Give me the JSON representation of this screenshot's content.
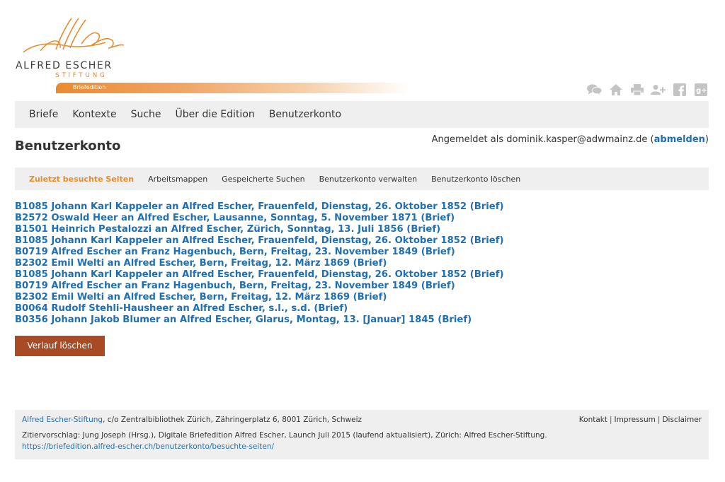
{
  "logo": {
    "name": "ALFRED ESCHER",
    "sub": "STIFTUNG",
    "badge": "Briefedition"
  },
  "colors": {
    "accent": "#e98b2f",
    "link": "#1f6fb5",
    "button": "#a84b25",
    "nav_bg": "#efefef"
  },
  "icons": [
    "comments-icon",
    "home-icon",
    "print-icon",
    "add-user-icon",
    "facebook-icon",
    "google-plus-icon"
  ],
  "nav": [
    "Briefe",
    "Kontexte",
    "Suche",
    "Über die Edition",
    "Benutzerkonto"
  ],
  "page": {
    "title": "Benutzerkonto",
    "login_prefix": "Angemeldet als dominik.kasper@adwmainz.de (",
    "logout": "abmelden",
    "login_suffix": ")"
  },
  "subnav": {
    "active": "Zuletzt besuchte Seiten",
    "items": [
      "Arbeitsmappen",
      "Gespeicherte Suchen",
      "Benutzerkonto verwalten",
      "Benutzerkonto löschen"
    ]
  },
  "visited": [
    "B1085 Johann Karl Kappeler an Alfred Escher, Frauenfeld, Dienstag, 26. Oktober 1852 (Brief)",
    "B2572 Oswald Heer an Alfred Escher, Lausanne, Sonntag, 5. November 1871 (Brief)",
    "B1501 Heinrich Pestalozzi an Alfred Escher, Zürich, Sonntag, 13. Juli 1856 (Brief)",
    "B1085 Johann Karl Kappeler an Alfred Escher, Frauenfeld, Dienstag, 26. Oktober 1852 (Brief)",
    "B0719 Alfred Escher an Franz Hagenbuch, Bern, Freitag, 23. November 1849 (Brief)",
    "B2302 Emil Welti an Alfred Escher, Bern, Freitag, 12. März 1869 (Brief)",
    "B1085 Johann Karl Kappeler an Alfred Escher, Frauenfeld, Dienstag, 26. Oktober 1852 (Brief)",
    "B0719 Alfred Escher an Franz Hagenbuch, Bern, Freitag, 23. November 1849 (Brief)",
    "B2302 Emil Welti an Alfred Escher, Bern, Freitag, 12. März 1869 (Brief)",
    "B0064 Rudolf Stehli-Hausheer an Alfred Escher, s.l., s.d. (Brief)",
    "B0356 Johann Jakob Blumer an Alfred Escher, Glarus, Montag, 13. [Januar] 1845 (Brief)"
  ],
  "clear_button": "Verlauf löschen",
  "footer": {
    "org": "Alfred Escher-Stiftung",
    "address": ", c/o Zentralbibliothek Zürich, Zähringerplatz 6, 8001 Zürich, Schweiz",
    "links": [
      "Kontakt",
      "Impressum",
      "Disclaimer"
    ],
    "separator": "|",
    "citation": "Zitiervorschlag: Jung Joseph (Hrsg.), Digitale Briefedition Alfred Escher, Launch Juli 2015 (laufend aktualisiert), Zürich: Alfred Escher-Stiftung.",
    "url": "https://briefedition.alfred-escher.ch/benutzerkonto/besuchte-seiten/"
  }
}
